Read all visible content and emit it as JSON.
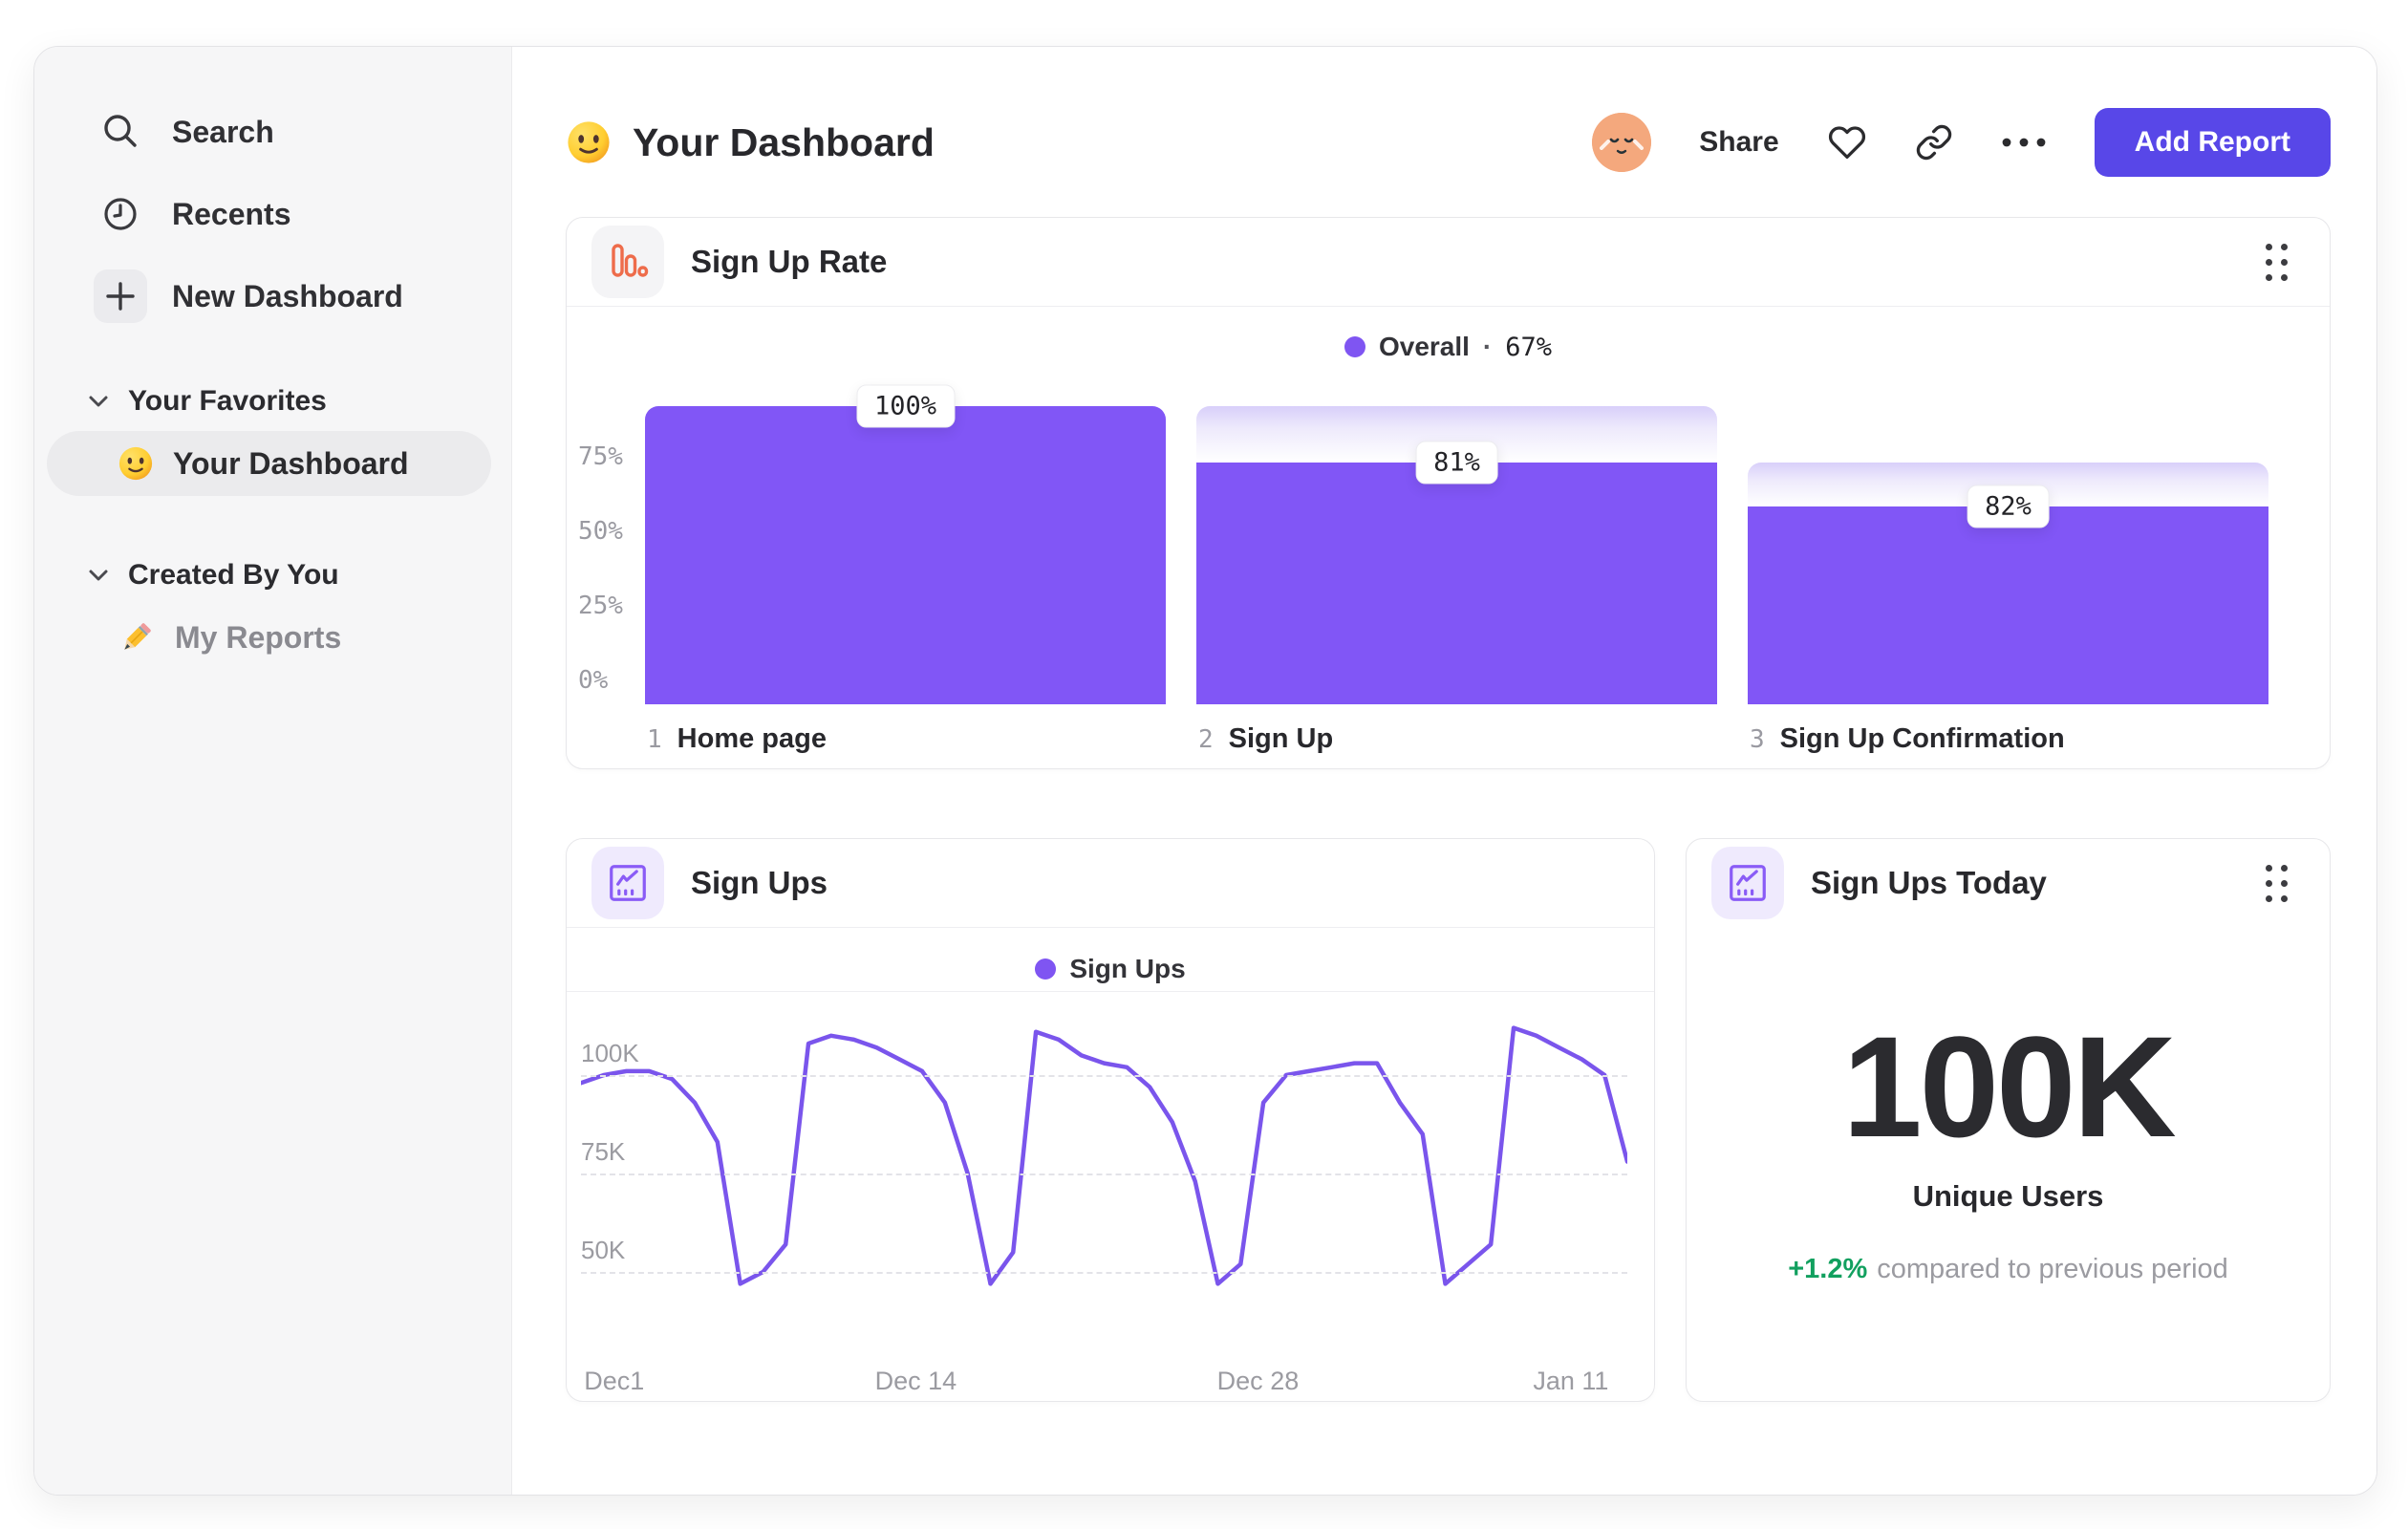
{
  "sidebar": {
    "items": [
      {
        "label": "Search",
        "icon": "search-icon"
      },
      {
        "label": "Recents",
        "icon": "clock-icon"
      },
      {
        "label": "New Dashboard",
        "icon": "plus-icon"
      }
    ],
    "favorites_title": "Your Favorites",
    "favorites_item": {
      "label": "Your Dashboard",
      "icon": "smiley-emoji"
    },
    "created_title": "Created By You",
    "created_item": {
      "label": "My Reports",
      "icon": "pencil-emoji"
    }
  },
  "header": {
    "title": "Your Dashboard",
    "share_label": "Share",
    "add_report_label": "Add Report"
  },
  "colors": {
    "accent_purple": "#8156F6",
    "legend_purple": "#7F55F2",
    "button_purple": "#5847E8",
    "icon_orange": "#EE6C4B",
    "delta_green": "#12A05F"
  },
  "chart_data": [
    {
      "type": "bar",
      "variant": "funnel",
      "title": "Sign Up Rate",
      "legend": {
        "label": "Overall",
        "separator": "·",
        "value": "67%"
      },
      "y_ticks": [
        {
          "label": "0%",
          "value": 0
        },
        {
          "label": "25%",
          "value": 25
        },
        {
          "label": "50%",
          "value": 50
        },
        {
          "label": "75%",
          "value": 75
        }
      ],
      "ylim": [
        0,
        100
      ],
      "steps": [
        {
          "index": "1",
          "label": "Home page",
          "conversion_label": "100%",
          "conversion_from_previous_pct": 100,
          "absolute_pct": 100
        },
        {
          "index": "2",
          "label": "Sign Up",
          "conversion_label": "81%",
          "conversion_from_previous_pct": 81,
          "absolute_pct": 81
        },
        {
          "index": "3",
          "label": "Sign Up Confirmation",
          "conversion_label": "82%",
          "conversion_from_previous_pct": 82,
          "absolute_pct": 66.4
        }
      ]
    },
    {
      "type": "line",
      "title": "Sign Ups",
      "legend": {
        "label": "Sign Ups"
      },
      "unit": "K",
      "ylim": [
        40,
        115
      ],
      "y_ticks": [
        {
          "label": "50K",
          "value": 50
        },
        {
          "label": "75K",
          "value": 75
        },
        {
          "label": "100K",
          "value": 100
        }
      ],
      "x_tick_labels": [
        {
          "label": "Dec1",
          "pos_pct": 0.3,
          "align": "left"
        },
        {
          "label": "Dec 14",
          "pos_pct": 32
        },
        {
          "label": "Dec 28",
          "pos_pct": 64.7
        },
        {
          "label": "Jan 11",
          "pos_pct": 94.6
        }
      ],
      "values": [
        98,
        100,
        101,
        101,
        99,
        93,
        83,
        47,
        50,
        57,
        108,
        110,
        109,
        107,
        104,
        101,
        93,
        75,
        47,
        55,
        111,
        109,
        105,
        103,
        102,
        97,
        88,
        73,
        47,
        52,
        93,
        100,
        101,
        102,
        103,
        103,
        93,
        85,
        47,
        52,
        57,
        112,
        110,
        107,
        104,
        100,
        78
      ]
    },
    {
      "type": "big_number",
      "title": "Sign Ups Today",
      "value": "100K",
      "label": "Unique Users",
      "delta": "+1.2%",
      "comparison_text": "compared to previous period"
    }
  ]
}
